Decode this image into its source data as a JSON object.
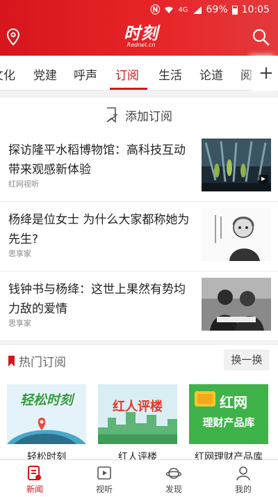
{
  "status_bar": {
    "network": "4G",
    "battery": "69%",
    "time": "10:05"
  },
  "header": {
    "logo_text": "时刻",
    "logo_sub": "Rednet.cn"
  },
  "tabs": [
    "文化",
    "党建",
    "呼声",
    "订阅",
    "生活",
    "论道",
    "阅"
  ],
  "active_tab": "订阅",
  "add_subscription": {
    "label": "添加订阅"
  },
  "news": [
    {
      "title": "探访隆平水稻博物馆：高科技互动带来观感新体验",
      "source": "红网视听"
    },
    {
      "title": "杨绛是位女士 为什么大家都称她为先生?",
      "source": "思享家"
    },
    {
      "title": "钱钟书与杨绛：这世上果然有势均力敌的爱情",
      "source": "思享家"
    }
  ],
  "hot": {
    "title": "热门订阅",
    "swap_label": "换一换",
    "cards": [
      {
        "name": "轻松时刻",
        "badge": "轻松时刻"
      },
      {
        "name": "红人评楼",
        "badge": "红人评楼"
      },
      {
        "name": "红网理财产品库",
        "badge_line1": "红网",
        "badge_line2": "理财产品库"
      }
    ]
  },
  "bottom_nav": [
    {
      "label": "新闻"
    },
    {
      "label": "视听"
    },
    {
      "label": "发现"
    },
    {
      "label": "我的"
    }
  ],
  "colors": {
    "brand_red": "#d6161c",
    "card_green": "#3fb24a"
  }
}
